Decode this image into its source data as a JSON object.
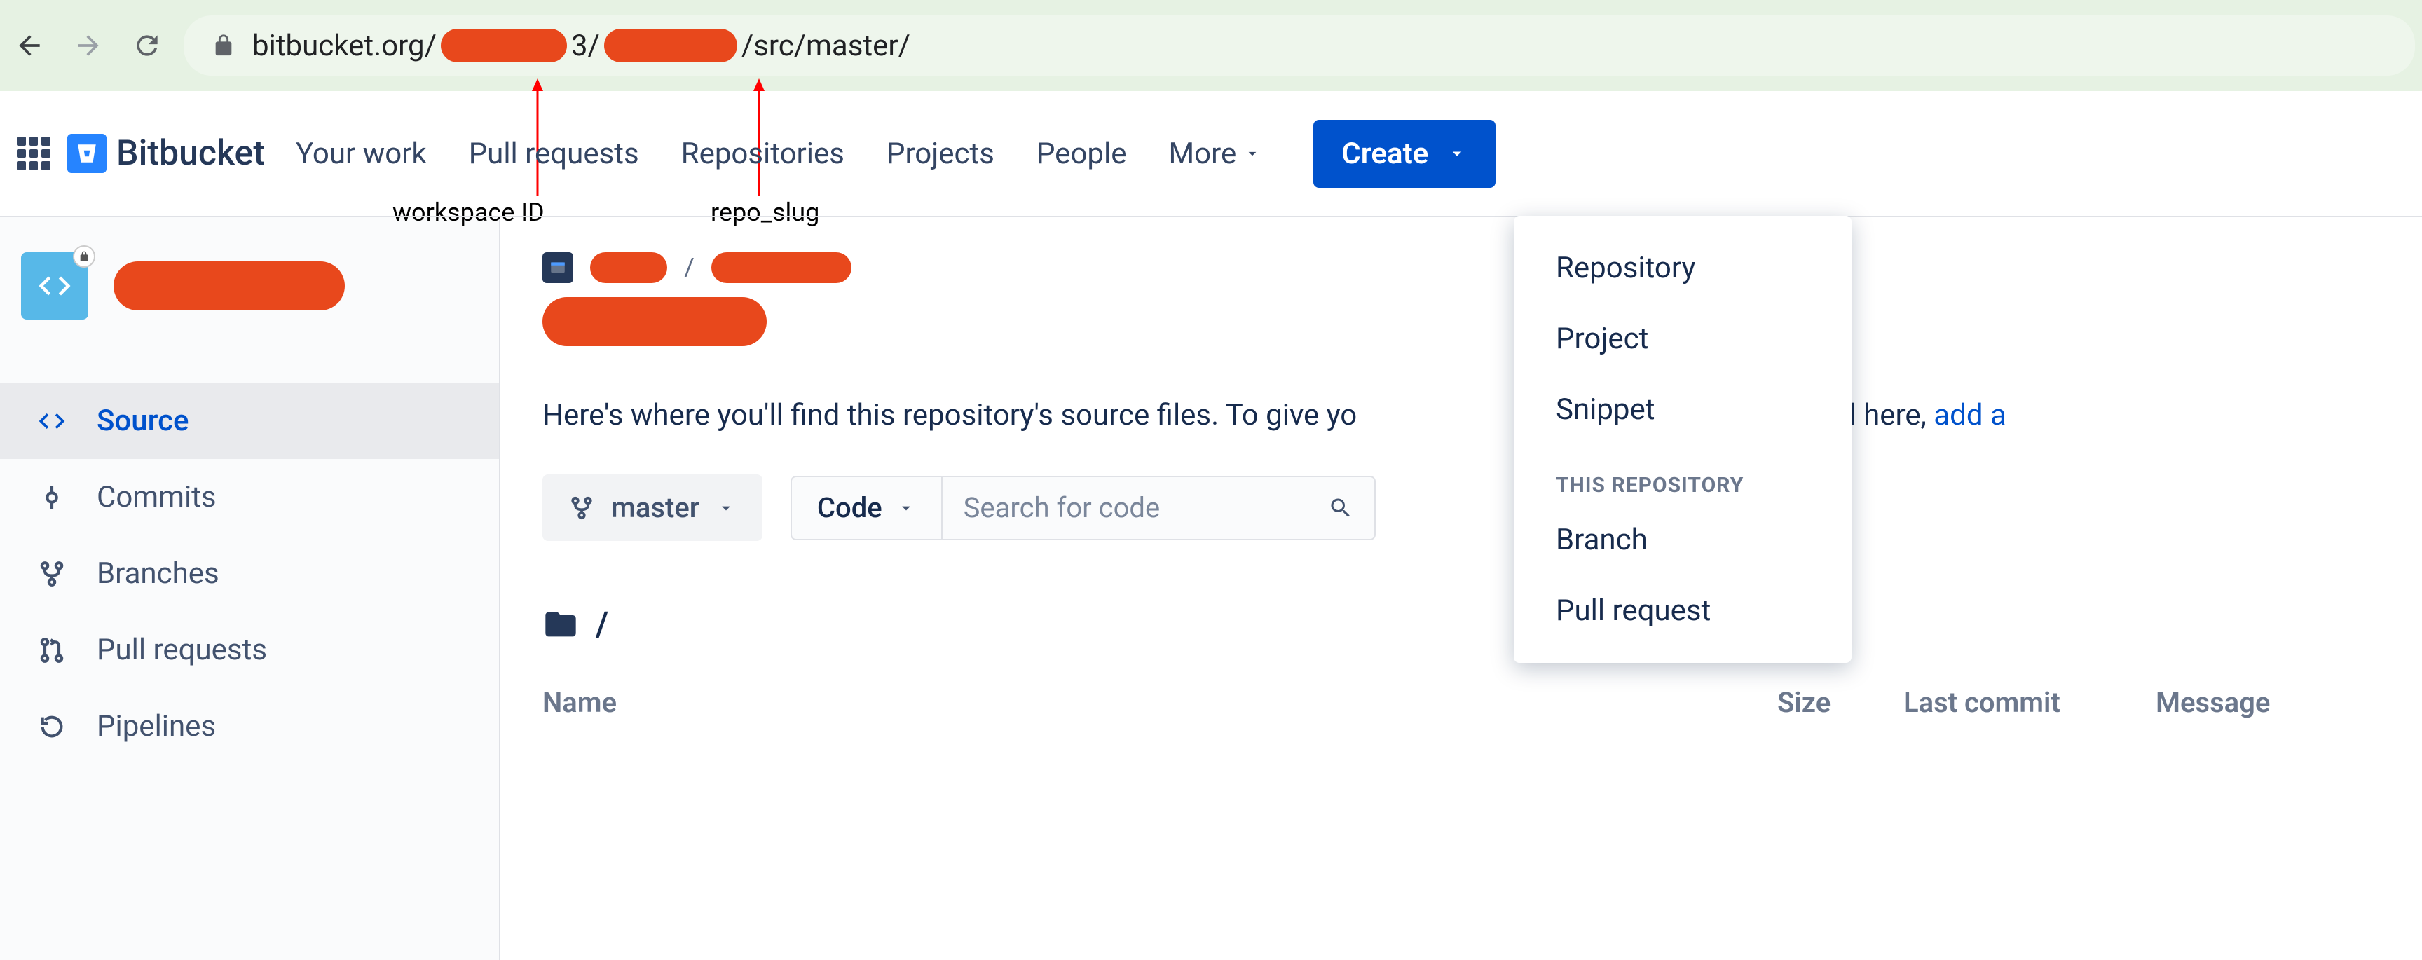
{
  "browser": {
    "url_prefix": "bitbucket.org/",
    "url_mid": "3/",
    "url_suffix": "/src/master/"
  },
  "annotations": {
    "workspace_id": "workspace ID",
    "repo_slug": "repo_slug"
  },
  "topnav": {
    "brand": "Bitbucket",
    "items": [
      "Your work",
      "Pull requests",
      "Repositories",
      "Projects",
      "People",
      "More"
    ],
    "create_label": "Create"
  },
  "dropdown": {
    "items_top": [
      "Repository",
      "Project",
      "Snippet"
    ],
    "heading": "THIS REPOSITORY",
    "items_bottom": [
      "Branch",
      "Pull request"
    ]
  },
  "sidebar": {
    "items": [
      {
        "label": "Source"
      },
      {
        "label": "Commits"
      },
      {
        "label": "Branches"
      },
      {
        "label": "Pull requests"
      },
      {
        "label": "Pipelines"
      }
    ]
  },
  "main": {
    "breadcrumb_sep": "/",
    "description_lead": "Here's where you'll find this repository's source files. To give yo",
    "description_tail": "t they'll find here, ",
    "description_link": "add a",
    "branch_label": "master",
    "code_label": "Code",
    "search_placeholder": "Search for code",
    "path_sep": "/",
    "columns": {
      "name": "Name",
      "size": "Size",
      "commit": "Last commit",
      "message": "Message"
    }
  }
}
